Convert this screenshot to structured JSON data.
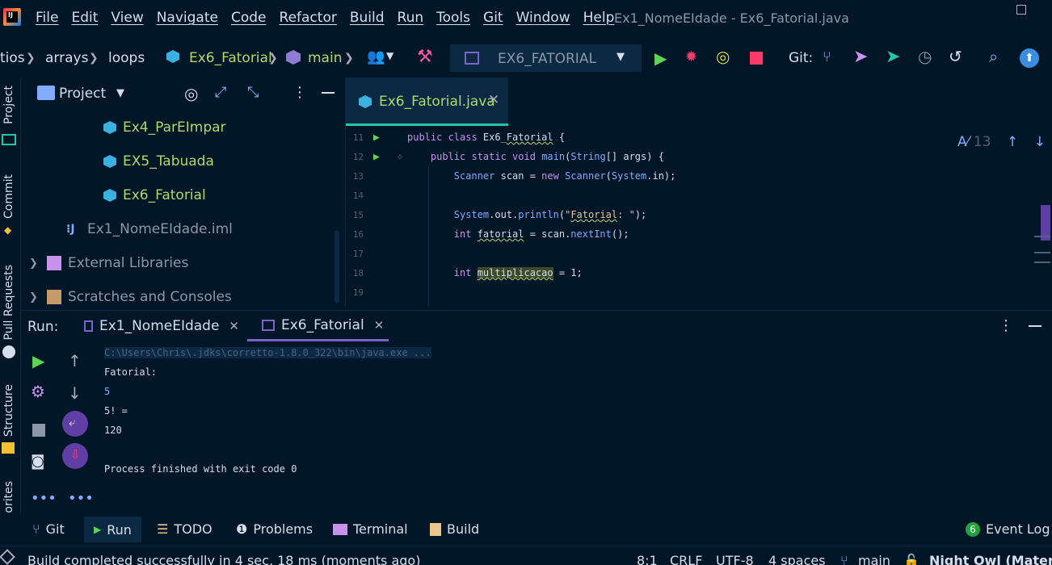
{
  "menubar": {
    "items": [
      "File",
      "Edit",
      "View",
      "Navigate",
      "Code",
      "Refactor",
      "Build",
      "Run",
      "Tools",
      "Git",
      "Window",
      "Help"
    ],
    "title": "Ex1_NomeEIdade - Ex6_Fatorial.java"
  },
  "breadcrumbs": [
    "tios",
    "arrays",
    "loops",
    "Ex6_Fatorial",
    "main"
  ],
  "toolbar": {
    "run_config": "EX6_FATORIAL",
    "git_label": "Git:"
  },
  "left_strip": [
    "Project",
    "Commit",
    "Pull Requests",
    "Structure",
    "orites"
  ],
  "project": {
    "title": "Project",
    "items": [
      {
        "label": "Ex4_ParEImpar"
      },
      {
        "label": "EX5_Tabuada"
      },
      {
        "label": "Ex6_Fatorial"
      },
      {
        "label": "Ex1_NomeEIdade.iml"
      },
      {
        "label": "External Libraries"
      },
      {
        "label": "Scratches and Consoles"
      }
    ]
  },
  "editor": {
    "tab": "Ex6_Fatorial.java",
    "inspection_count": "13",
    "lines": [
      {
        "n": "11",
        "code": "public class Ex6_Fatorial {"
      },
      {
        "n": "12",
        "code": "    public static void main(String[] args) {"
      },
      {
        "n": "13",
        "code": "        Scanner scan = new Scanner(System.in);"
      },
      {
        "n": "14",
        "code": ""
      },
      {
        "n": "15",
        "code": "        System.out.println(\"Fatorial: \");"
      },
      {
        "n": "16",
        "code": "        int fatorial = scan.nextInt();"
      },
      {
        "n": "17",
        "code": ""
      },
      {
        "n": "18",
        "code": "        int multiplicacao = 1;"
      },
      {
        "n": "19",
        "code": ""
      }
    ]
  },
  "run": {
    "label": "Run:",
    "tabs": [
      "Ex1_NomeEIdade",
      "Ex6_Fatorial"
    ],
    "output": [
      "C:\\Users\\Chris\\.jdks\\corretto-1.8.0_322\\bin\\java.exe ...",
      "Fatorial:",
      "5",
      "5! =",
      "120",
      "",
      "Process finished with exit code 0"
    ]
  },
  "bottom_tools": [
    "Git",
    "Run",
    "TODO",
    "Problems",
    "Terminal",
    "Build"
  ],
  "event_log": {
    "count": "6",
    "label": "Event Log"
  },
  "status": {
    "message": "Build completed successfully in 4 sec, 18 ms (moments ago)",
    "position": "8:1",
    "line_ending": "CRLF",
    "encoding": "UTF-8",
    "indent": "4 spaces",
    "branch": "main",
    "theme": "Night Owl (Material)"
  },
  "colors": {
    "background": "#011627",
    "accent": "#21c7a8",
    "keyword": "#c792ea",
    "string": "#ecc48d",
    "type": "#82aaff"
  }
}
